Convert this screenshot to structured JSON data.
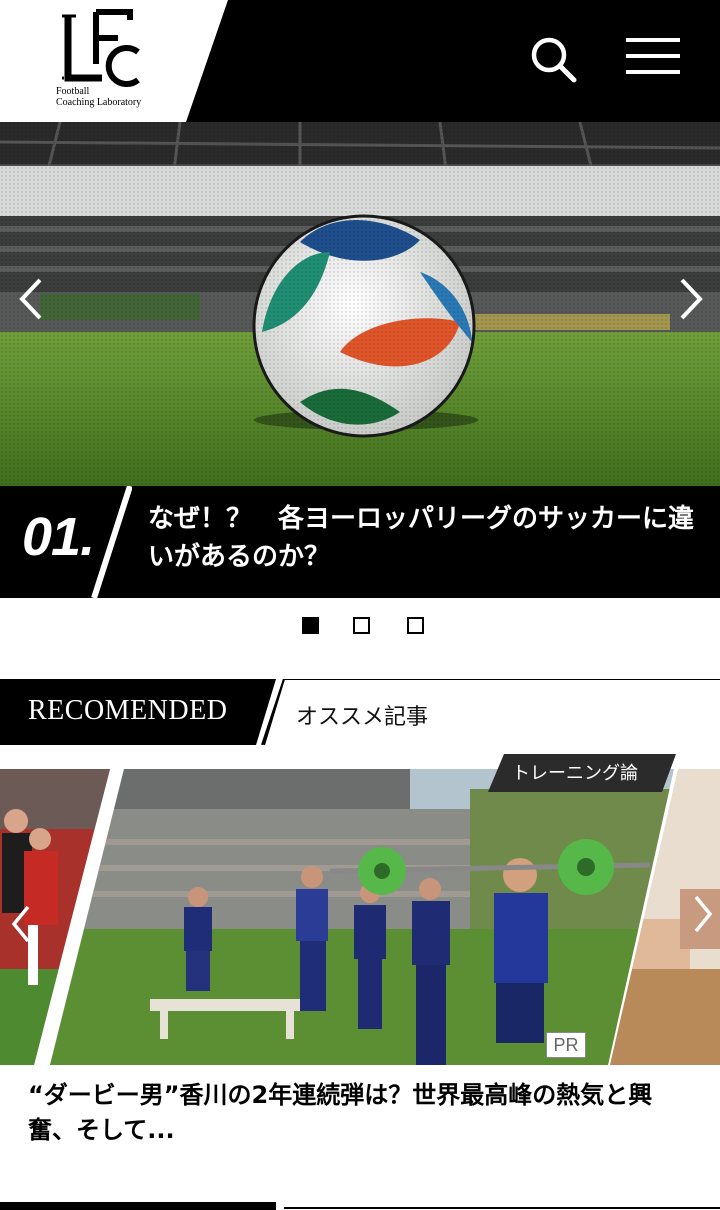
{
  "header": {
    "logo_letters": "LFC",
    "logo_line1": "Football",
    "logo_line2": "Coaching Laboratory",
    "search_icon": "search-icon",
    "menu_icon": "hamburger-menu-icon"
  },
  "hero": {
    "number": "01.",
    "title": "なぜ！？　各ヨーロッパリーグのサッカーに違いがあるのか？",
    "prev_icon": "chevron-left-icon",
    "next_icon": "chevron-right-icon",
    "slides_total": 3,
    "active_slide": 1
  },
  "recommended": {
    "heading_en": "RECOMENDED",
    "heading_jp": "オススメ記事"
  },
  "card": {
    "category": "トレーニング論",
    "badge": "PR",
    "title": "“ダービー男”香川の2年連続弾は？世界最高峰の熱気と興奮、そして..."
  },
  "colors": {
    "black": "#000000",
    "white": "#ffffff",
    "tag_bg": "#2b2b2b",
    "grass": "#4f8a2a"
  }
}
